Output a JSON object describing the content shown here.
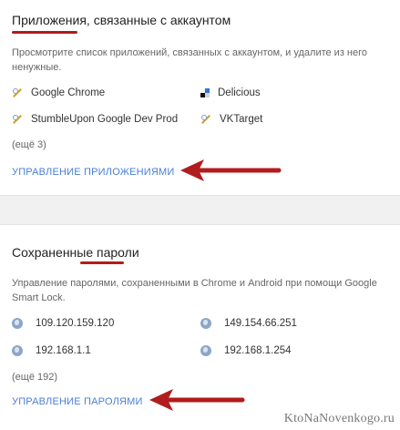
{
  "apps_section": {
    "title": "Приложения, связанные с аккаунтом",
    "description": "Просмотрите список приложений, связанных с аккаунтом, и удалите из него ненужные.",
    "apps": [
      {
        "name": "Google Chrome",
        "icon": "wrench-icon"
      },
      {
        "name": "Delicious",
        "icon": "delicious-icon"
      },
      {
        "name": "StumbleUpon Google Dev Prod",
        "icon": "wrench-icon"
      },
      {
        "name": "VKTarget",
        "icon": "wrench-icon"
      }
    ],
    "more": "(ещё 3)",
    "manage_link": "УПРАВЛЕНИЕ ПРИЛОЖЕНИЯМИ"
  },
  "passwords_section": {
    "title": "Сохраненные пароли",
    "description": "Управление паролями, сохраненными в Chrome и Android при помощи Google Smart Lock.",
    "sites": [
      {
        "name": "109.120.159.120",
        "icon": "globe-icon"
      },
      {
        "name": "149.154.66.251",
        "icon": "globe-icon"
      },
      {
        "name": "192.168.1.1",
        "icon": "globe-icon"
      },
      {
        "name": "192.168.1.254",
        "icon": "globe-icon"
      }
    ],
    "more": "(ещё 192)",
    "manage_link": "УПРАВЛЕНИЕ ПАРОЛЯМИ"
  },
  "watermark": "KtoNaNovenkogo.ru",
  "colors": {
    "link": "#4a7fd6",
    "annotation_red": "#b11c1c",
    "page_bg": "#f1f1f1"
  }
}
